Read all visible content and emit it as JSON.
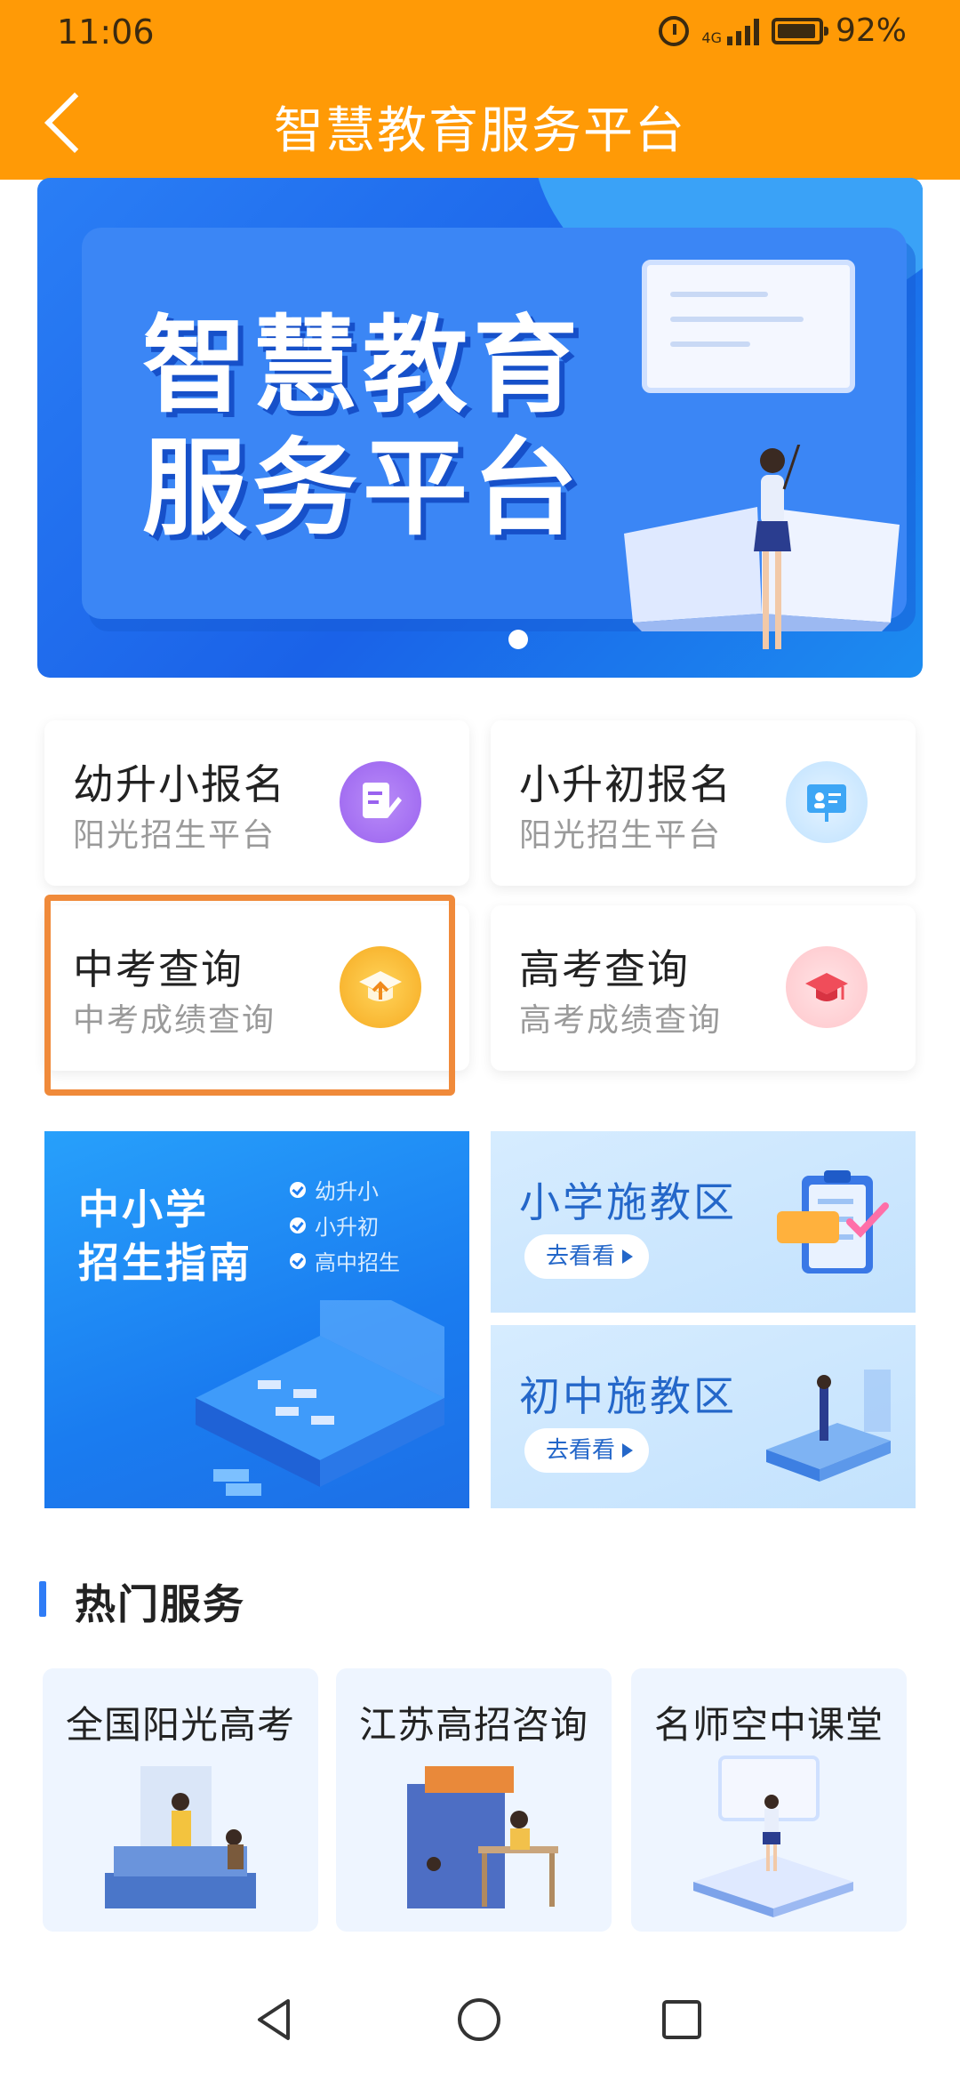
{
  "status_bar": {
    "time": "11:06",
    "network": "4G",
    "battery": "92%"
  },
  "header": {
    "title": "智慧教育服务平台"
  },
  "banner": {
    "line1": "智慧教育",
    "line2": "服务平台"
  },
  "services": [
    {
      "title": "幼升小报名",
      "subtitle": "阳光招生平台",
      "icon": "edit-note-icon",
      "color": "#a06cf0"
    },
    {
      "title": "小升初报名",
      "subtitle": "阳光招生平台",
      "icon": "presentation-board-icon",
      "color": "#3ea6f5"
    },
    {
      "title": "中考查询",
      "subtitle": "中考成绩查询",
      "icon": "graduation-cap-icon",
      "color": "#f5b52e"
    },
    {
      "title": "高考查询",
      "subtitle": "高考成绩查询",
      "icon": "mortarboard-icon",
      "color": "#f04d5a"
    }
  ],
  "tiles": {
    "guide": {
      "line1": "中小学",
      "line2": "招生指南",
      "checks": [
        "幼升小",
        "小升初",
        "高中招生"
      ]
    },
    "primary": {
      "title": "小学施教区",
      "button": "去看看"
    },
    "junior": {
      "title": "初中施教区",
      "button": "去看看"
    }
  },
  "hot_services": {
    "title": "热门服务",
    "items": [
      "全国阳光高考",
      "江苏高招咨询",
      "名师空中课堂"
    ]
  },
  "colors": {
    "accent": "#ff9a06",
    "primary_blue": "#1a62e8",
    "highlight": "#f08a3a"
  }
}
